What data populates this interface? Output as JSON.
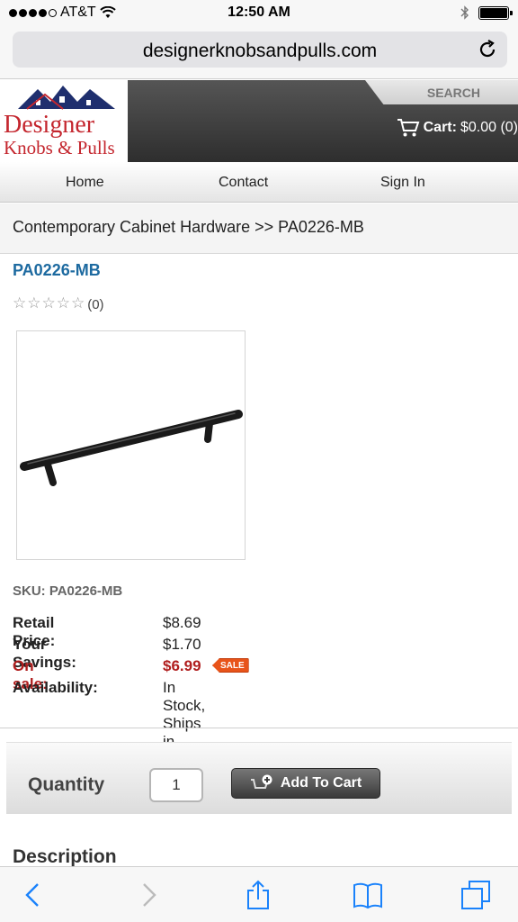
{
  "status_bar": {
    "carrier": "AT&T",
    "time": "12:50 AM"
  },
  "browser": {
    "url": "designerknobsandpulls.com"
  },
  "site": {
    "logo_line1": "Designer",
    "logo_line2": "Knobs & Pulls",
    "search_label": "SEARCH",
    "cart_label": "Cart:",
    "cart_value": "$0.00 (0)"
  },
  "nav": {
    "items": [
      {
        "label": "Home"
      },
      {
        "label": "Contact"
      },
      {
        "label": "Sign In"
      }
    ]
  },
  "breadcrumb": "Contemporary Cabinet Hardware >> PA0226-MB",
  "product": {
    "title": "PA0226-MB",
    "rating_stars": "☆☆☆☆☆",
    "rating_count": "(0)",
    "sku_line": "SKU: PA0226-MB",
    "retail_label": "Retail Price:",
    "retail_value": "$8.69",
    "savings_label": "Your Savings:",
    "savings_value": "$1.70",
    "sale_label": "On sale:",
    "sale_value": "$6.99",
    "sale_badge": "SALE",
    "availability_label": "Availability:",
    "availability_value": "In Stock, Ships in One Day"
  },
  "purchase": {
    "quantity_label": "Quantity",
    "quantity_value": "1",
    "add_to_cart_label": "Add To Cart"
  },
  "description_heading": "Description",
  "colors": {
    "link_blue": "#1d6aa0",
    "sale_red": "#b01e1e",
    "brand_red": "#c4262e",
    "ios_blue": "#1a82fb"
  }
}
